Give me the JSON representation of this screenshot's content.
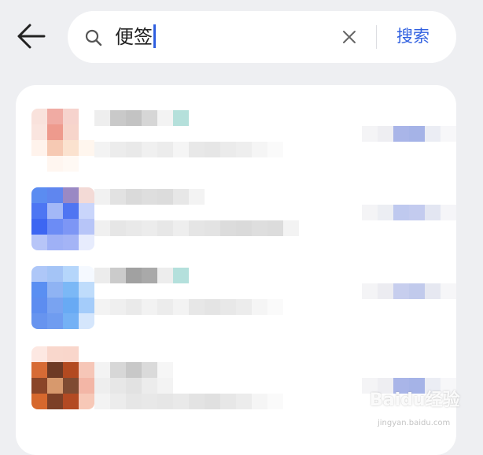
{
  "header": {
    "search_value": "便签",
    "search_button_label": "搜索"
  },
  "icons": {
    "back": "arrow-left-icon",
    "search": "search-icon",
    "clear": "close-icon"
  },
  "colors": {
    "accent": "#2f5fe0",
    "background": "#eeeff2",
    "card": "#ffffff"
  },
  "watermark": {
    "brand": "Baidu经验",
    "url": "jingyan.baidu.com"
  }
}
